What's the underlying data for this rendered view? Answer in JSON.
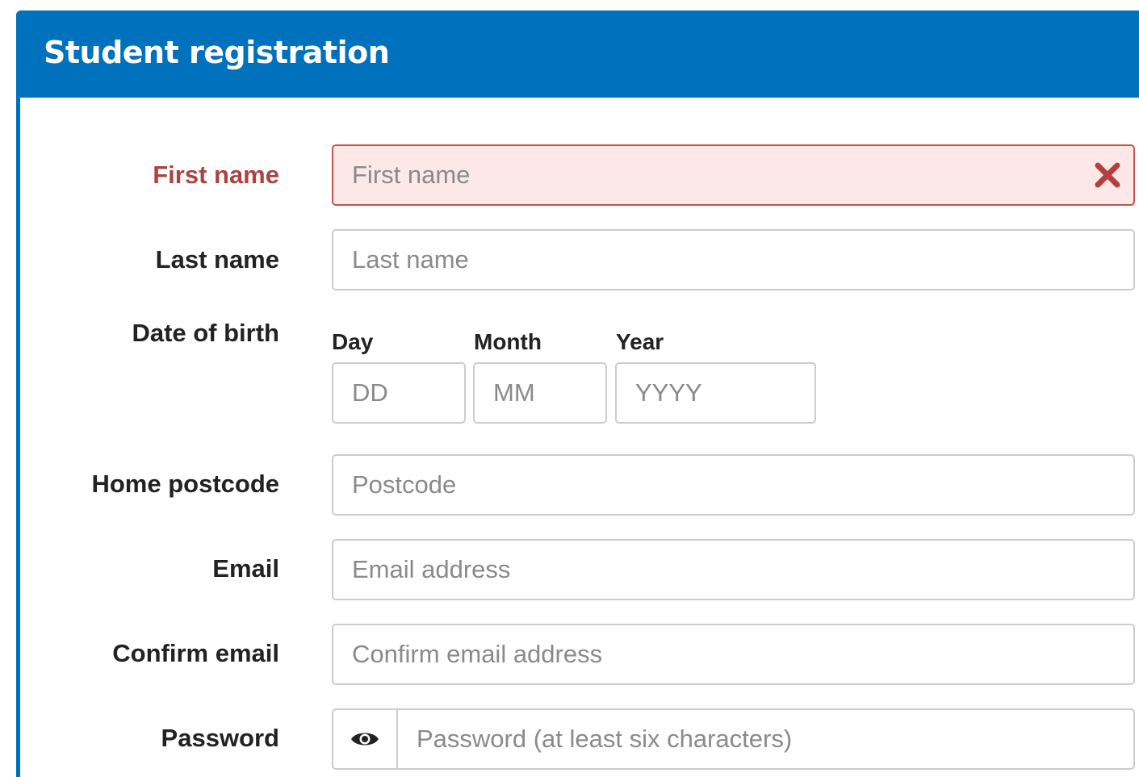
{
  "form": {
    "title": "Student registration",
    "first_name": {
      "label": "First name",
      "placeholder": "First name"
    },
    "last_name": {
      "label": "Last name",
      "placeholder": "Last name"
    },
    "dob": {
      "label": "Date of birth",
      "day_label": "Day",
      "day_placeholder": "DD",
      "month_label": "Month",
      "month_placeholder": "MM",
      "year_label": "Year",
      "year_placeholder": "YYYY"
    },
    "postcode": {
      "label": "Home postcode",
      "placeholder": "Postcode"
    },
    "email": {
      "label": "Email",
      "placeholder": "Email address"
    },
    "confirm_email": {
      "label": "Confirm email",
      "placeholder": "Confirm email address"
    },
    "password": {
      "label": "Password",
      "placeholder": "Password (at least six characters)",
      "toggle_icon": "eye-icon"
    }
  },
  "colors": {
    "header": "#0071bc",
    "error_text": "#a94442",
    "error_border": "#c9524e",
    "error_background": "#fde8e8",
    "error_icon": "#b3403c"
  }
}
